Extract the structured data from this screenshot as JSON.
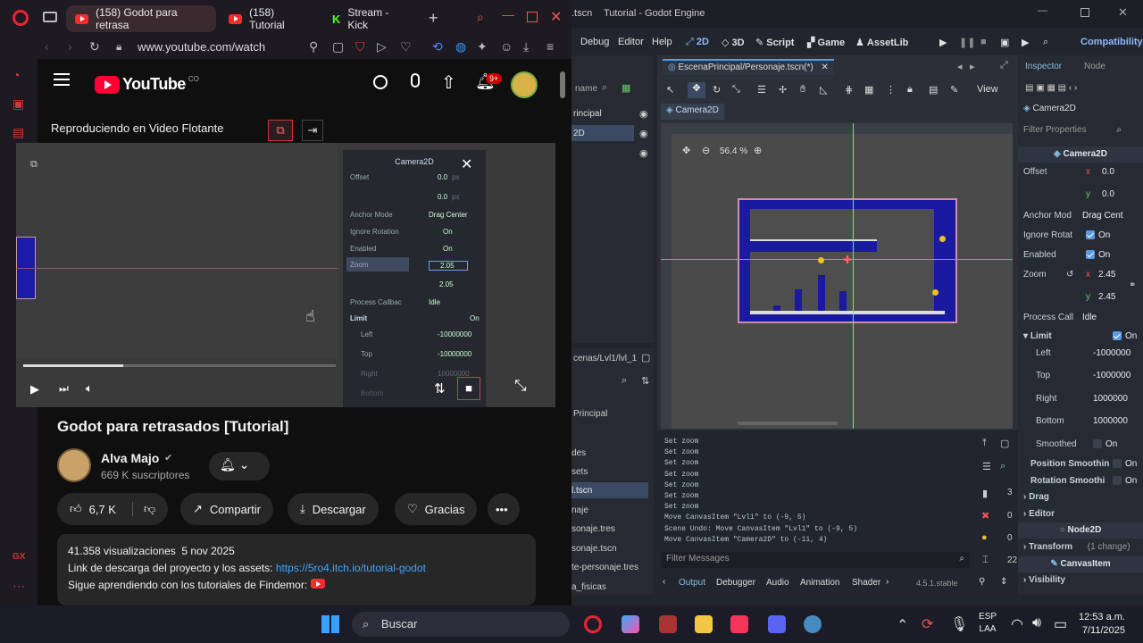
{
  "browser": {
    "tabs": [
      {
        "label": "(158) Godot para retrasa",
        "active": true
      },
      {
        "label": "(158) Tutorial",
        "active": false
      },
      {
        "label": "Stream - Kick",
        "active": false
      }
    ],
    "new_tab": "+",
    "url": "www.youtube.com/watch"
  },
  "youtube": {
    "logo_text": "YouTube",
    "country_code": "CO",
    "notif_count": "9+",
    "miniplayer_label": "Reproduciendo en Video Flotante",
    "title": "Godot para retrasados [Tutorial]",
    "channel_name": "Alva Majo",
    "subscribers": "669 K suscriptores",
    "likes": "6,7 K",
    "share": "Compartir",
    "download": "Descargar",
    "thanks": "Gracias",
    "more": "•••",
    "views": "41.358 visualizaciones",
    "date": "5 nov 2025",
    "desc_line1": "Link de descarga del proyecto y los assets:",
    "desc_link": "https://5ro4.itch.io/tutorial-godot",
    "desc_line2": "Sigue aprendiendo con los tutoriales de Findemor:"
  },
  "video_inspector": {
    "title": "Camera2D",
    "offset": "Offset",
    "offset_x": "0.0",
    "offset_y": "0.0",
    "unit": "px",
    "anchor_mode": "Anchor Mode",
    "anchor_value": "Drag Center",
    "ignore_rotation": "Ignore Rotation",
    "enabled": "Enabled",
    "on": "On",
    "zoom": "Zoom",
    "zoom_x": "2.05",
    "zoom_y": "2.05",
    "process_callback": "Process Callbac",
    "process_value": "Idle",
    "limit": "Limit",
    "left": "Left",
    "top": "Top",
    "right": "Right",
    "bottom": "Bottom",
    "neg_limit": "-10000000",
    "pos_limit": "10000000"
  },
  "godot": {
    "window_title": "Tutorial - Godot Engine",
    "title_prefix": ".tscn",
    "menu": [
      "Debug",
      "Editor",
      "Help"
    ],
    "workspaces": [
      "2D",
      "3D",
      "Script",
      "Game",
      "AssetLib"
    ],
    "renderer": "Compatibility",
    "scene_tab": "EscenaPrincipal/Personaje.tscn(*)",
    "scene_tree_partial": [
      "name",
      "rincipal",
      "2D"
    ],
    "fs_path": "cenas/Lvl1/lvl_1",
    "fs_items": [
      "Principal",
      "des",
      "sets",
      "l.tscn",
      "naje",
      "sonaje.tres",
      "sonaje.tscn",
      "te-personaje.tres",
      "a_fisicas"
    ],
    "viewport_node": "Camera2D",
    "zoom_level": "56.4 %",
    "view_menu": "View",
    "output_lines": [
      "Set zoom",
      "Set zoom",
      "Set zoom",
      "Set zoom",
      "Set zoom",
      "Set zoom",
      "Set zoom",
      "Move CanvasItem \"Lvl1\" to (-9, 5)",
      "Scene Undo: Move CanvasItem \"Lvl1\" to (-9, 5)",
      "Move CanvasItem \"Camera2D\" to (-11, 4)"
    ],
    "filter_messages": "Filter Messages",
    "counts": {
      "logs": "3",
      "errors": "0",
      "warnings": "0",
      "others": "22"
    },
    "bottom_tabs": [
      "Output",
      "Debugger",
      "Audio",
      "Animation",
      "Shader"
    ],
    "version": "4.5.1.stable",
    "inspector": {
      "tab_inspector": "Inspector",
      "tab_node": "Node",
      "node": "Camera2D",
      "filter": "Filter Properties",
      "class": "Camera2D",
      "offset": "Offset",
      "offset_x": "0.0",
      "offset_y": "0.0",
      "anchor": "Anchor Mod",
      "anchor_value": "Drag Cent",
      "ignore_rot": "Ignore Rotat",
      "enabled": "Enabled",
      "on": "On",
      "zoom": "Zoom",
      "zoom_x": "2.45",
      "zoom_y": "2.45",
      "process": "Process Call",
      "process_value": "Idle",
      "limit": "Limit",
      "left": "Left",
      "top": "Top",
      "right": "Right",
      "bottom": "Bottom",
      "neg": "-1000000",
      "pos": "1000000",
      "smoothed": "Smoothed",
      "pos_smooth": "Position Smoothin",
      "rot_smooth": "Rotation Smoothi",
      "drag": "Drag",
      "editor": "Editor",
      "node2d": "Node2D",
      "transform": "Transform",
      "transform_changes": "(1 change)",
      "canvas_item": "CanvasItem",
      "visibility": "Visibility",
      "x": "x",
      "y": "y"
    }
  },
  "taskbar": {
    "search": "Buscar",
    "lang": "ESP",
    "lang2": "LAA",
    "time": "12:53 a.m.",
    "date": "7/11/2025"
  },
  "colors": {
    "yt_red": "#ff0033",
    "godot_accent": "#5a9be6",
    "level_blue": "#1a1aa0"
  }
}
